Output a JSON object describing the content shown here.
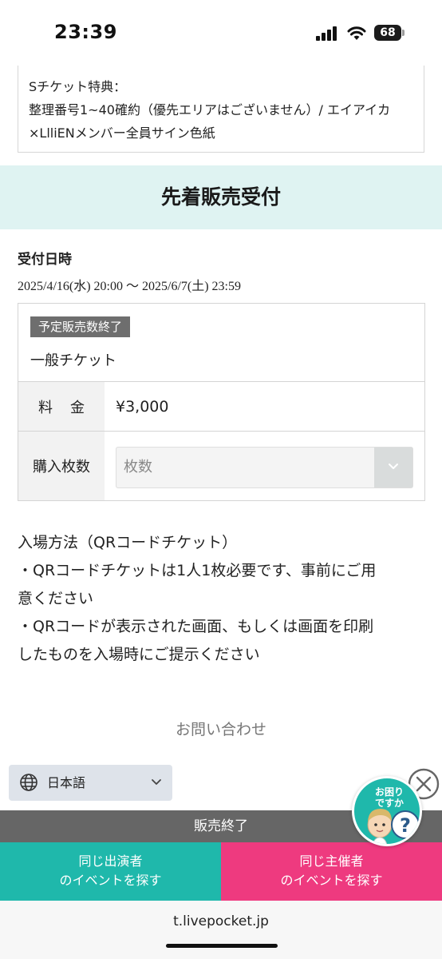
{
  "status_bar": {
    "time": "23:39",
    "battery": "68"
  },
  "benefit": {
    "lines": [
      "Sチケット特典：",
      "整理番号1~40確約（優先エリアはございません）/ エイアイカ",
      "×LlliENメンバー全員サイン色紙"
    ]
  },
  "section_title": "先着販売受付",
  "reception": {
    "label": "受付日時",
    "period": "2025/4/16(水) 20:00 〜 2025/6/7(土) 23:59"
  },
  "ticket": {
    "status_badge": "予定販売数終了",
    "name": "一般チケット",
    "price_label": "料金",
    "price": "¥3,000",
    "quantity_label": "購入枚数",
    "quantity_placeholder": "枚数"
  },
  "entry_info": {
    "lines": [
      "入場方法（QRコードチケット）",
      "・QRコードチケットは1人1枚必要です、事前にご用",
      "意ください",
      "・QRコードが表示された画面、もしくは画面を印刷",
      "したものを入場時にご提示ください"
    ]
  },
  "contact_link": "お問い合わせ",
  "language": {
    "selected": "日本語"
  },
  "help_widget": {
    "line1": "お困り",
    "line2": "ですか"
  },
  "sales_status": "販売終了",
  "buttons": {
    "same_performer": {
      "line1": "同じ出演者",
      "line2": "のイベントを探す"
    },
    "same_organizer": {
      "line1": "同じ主催者",
      "line2": "のイベントを探す"
    }
  },
  "browser": {
    "url": "t.livepocket.jp"
  },
  "colors": {
    "teal": "#1fb8ab",
    "pink": "#ee3a7f",
    "header_bg": "#dff3f2",
    "sold_badge": "#6e6e6e",
    "sales_ended_bar": "#666666"
  },
  "icons": [
    "signal-icon",
    "wifi-icon",
    "battery-icon",
    "globe-icon",
    "chevron-down-icon",
    "close-icon"
  ]
}
